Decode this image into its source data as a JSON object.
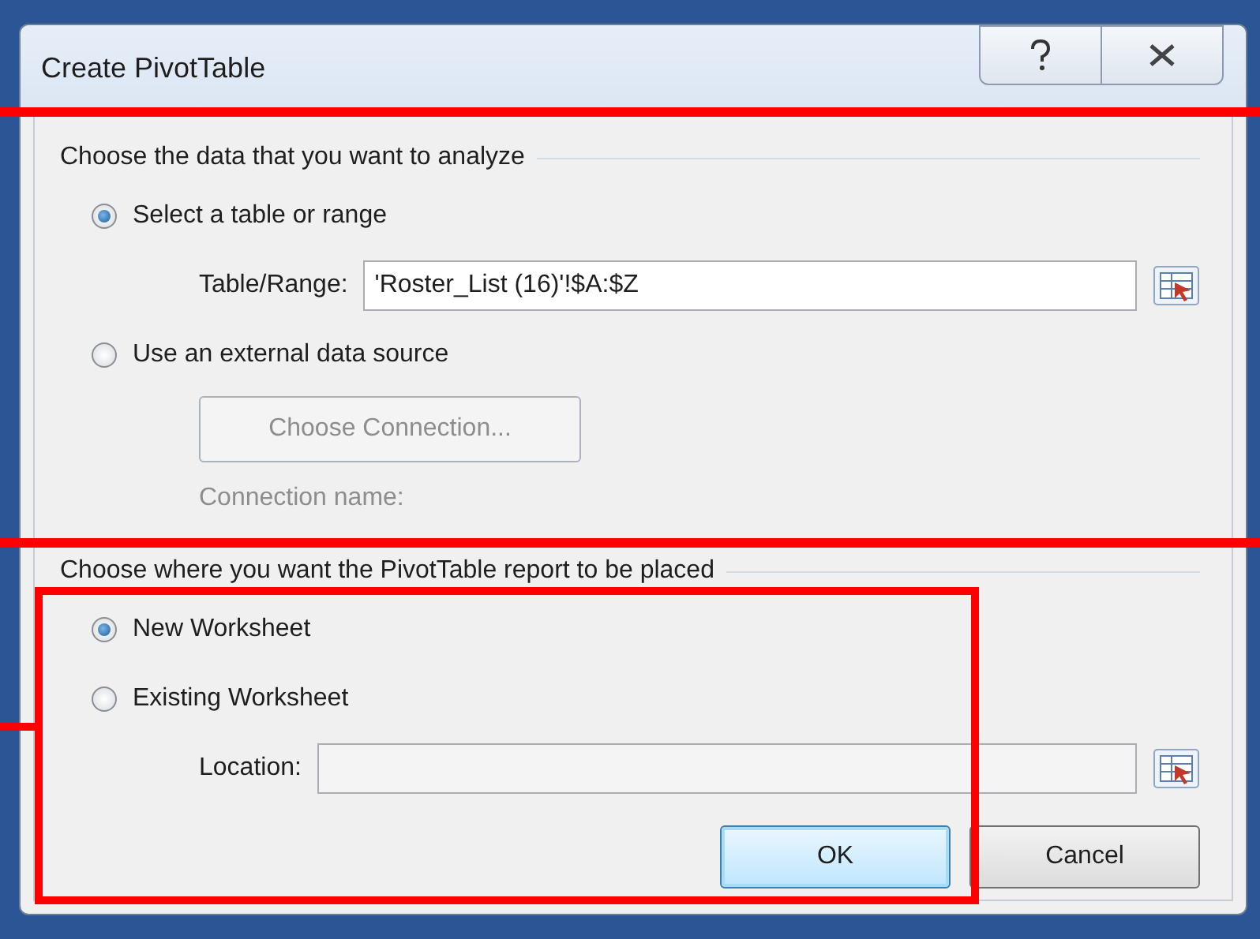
{
  "window": {
    "title": "Create PivotTable"
  },
  "data_section": {
    "heading": "Choose the data that you want to analyze",
    "options": [
      {
        "label": "Select a table or range",
        "selected": true
      },
      {
        "label": "Use an external data source",
        "selected": false
      }
    ],
    "range_field": {
      "label": "Table/Range:",
      "value": "'Roster_List (16)'!$A:$Z"
    },
    "connection_button": {
      "label": "Choose Connection...",
      "disabled": true
    },
    "connection_name": {
      "label": "Connection name:",
      "disabled": true
    }
  },
  "placement_section": {
    "heading": "Choose where you want the PivotTable report to be placed",
    "options": [
      {
        "label": "New Worksheet",
        "selected": true
      },
      {
        "label": "Existing Worksheet",
        "selected": false
      }
    ],
    "location_field": {
      "label": "Location:"
    }
  },
  "buttons": [
    {
      "label": "OK",
      "kind": "default"
    },
    {
      "label": "Cancel",
      "kind": "normal"
    }
  ]
}
